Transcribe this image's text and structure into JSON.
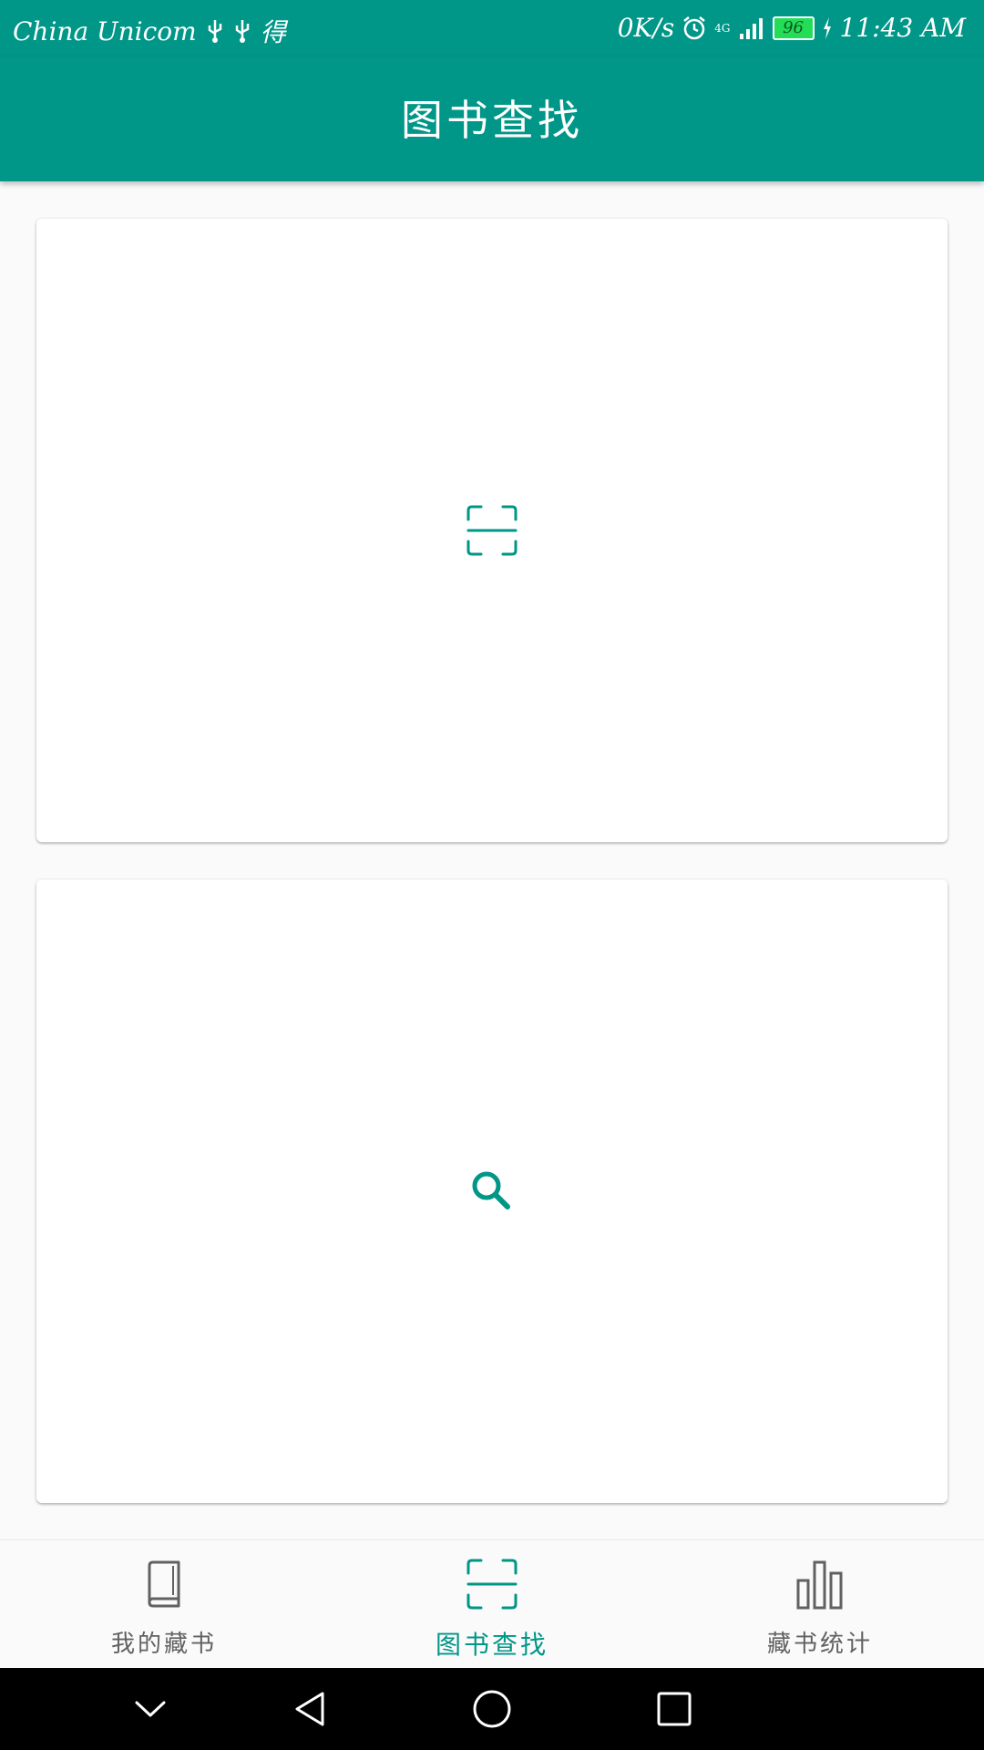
{
  "status_bar": {
    "carrier": "China Unicom",
    "extra_icon_text": "得",
    "network_speed": "0K/s",
    "network_type": "4G",
    "battery_level": "96",
    "time": "11:43 AM"
  },
  "app_bar": {
    "title": "图书查找"
  },
  "cards": [
    {
      "icon": "scan-icon"
    },
    {
      "icon": "search-icon"
    }
  ],
  "bottom_nav": {
    "items": [
      {
        "label": "我的藏书",
        "icon": "book-icon",
        "active": false
      },
      {
        "label": "图书查找",
        "icon": "scan-icon",
        "active": true
      },
      {
        "label": "藏书统计",
        "icon": "bar-chart-icon",
        "active": false
      }
    ]
  },
  "colors": {
    "primary": "#009688",
    "inactive": "#616161",
    "background": "#fafafa"
  }
}
